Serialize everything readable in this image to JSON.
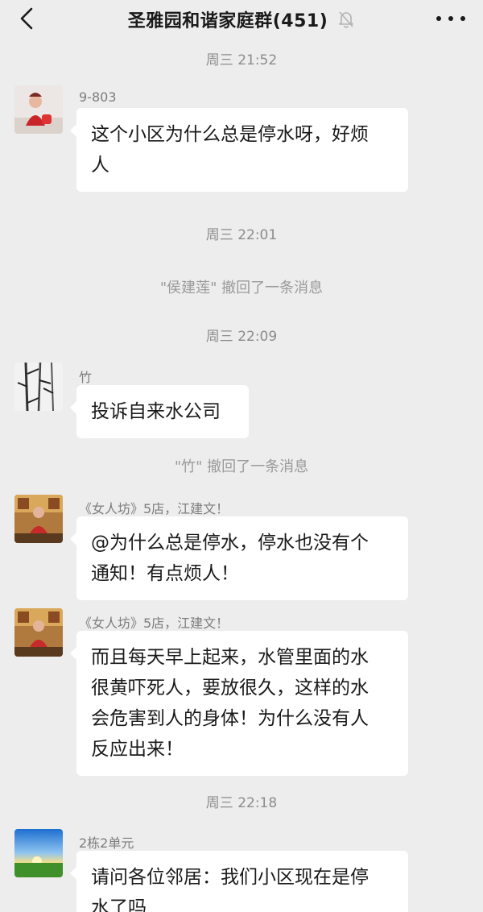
{
  "header": {
    "title": "圣雅园和谐家庭群(451)",
    "back_icon": "chevron-left-icon",
    "mute_icon": "bell-off-icon",
    "more_icon": "more-dots-icon"
  },
  "messages": [
    {
      "type": "time",
      "text": "周三 21:52"
    },
    {
      "type": "message",
      "sender": "9-803",
      "avatar": "child-photo-avatar",
      "lines": [
        "这个小区为什么总是停水呀，好烦",
        "人"
      ]
    },
    {
      "type": "time",
      "text": "周三 22:01"
    },
    {
      "type": "system",
      "text": "\"侯建莲\" 撤回了一条消息"
    },
    {
      "type": "time",
      "text": "周三 22:09"
    },
    {
      "type": "message",
      "sender": "竹",
      "avatar": "bamboo-painting-avatar",
      "lines": [
        "投诉自来水公司"
      ]
    },
    {
      "type": "system",
      "text": "\"竹\" 撤回了一条消息"
    },
    {
      "type": "message",
      "sender": "《女人坊》5店，江建文！",
      "avatar": "shop-photo-avatar",
      "lines": [
        "@为什么总是停水，停水也没有个",
        "通知！有点烦人！"
      ]
    },
    {
      "type": "message",
      "sender": "《女人坊》5店，江建文！",
      "avatar": "shop-photo-avatar",
      "lines": [
        "而且每天早上起来，水管里面的水",
        "很黄吓死人，要放很久，这样的水",
        "会危害到人的身体！为什么没有人",
        "反应出来！"
      ]
    },
    {
      "type": "time",
      "text": "周三 22:18"
    },
    {
      "type": "message",
      "sender": "2栋2单元",
      "avatar": "sunset-landscape-avatar",
      "lines": [
        "请问各位邻居：我们小区现在是停",
        "水了吗"
      ]
    }
  ]
}
